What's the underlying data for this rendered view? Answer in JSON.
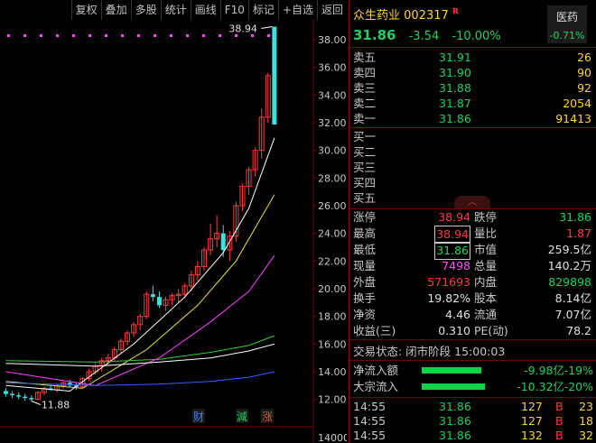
{
  "toolbar": [
    "复权",
    "叠加",
    "多股",
    "统计",
    "画线",
    "F10",
    "标记",
    "+自选",
    "返回"
  ],
  "chart_data": {
    "type": "candlestick",
    "y_ticks": [
      "38.00",
      "36.00",
      "34.00",
      "32.00",
      "30.00",
      "28.00",
      "26.00",
      "24.00",
      "22.00",
      "20.00",
      "18.00",
      "16.00",
      "14.00",
      "12.00"
    ],
    "y_range": [
      11.0,
      39.3
    ],
    "high_label": "38.94",
    "low_label": "11.88",
    "candles": [
      [
        12.6,
        12.8,
        12.2,
        12.4
      ],
      [
        12.4,
        12.6,
        12.1,
        12.3
      ],
      [
        12.3,
        12.5,
        12.0,
        12.2
      ],
      [
        12.2,
        12.4,
        11.9,
        12.1
      ],
      [
        12.1,
        12.3,
        11.88,
        12.0
      ],
      [
        12.0,
        12.6,
        11.95,
        12.5
      ],
      [
        12.5,
        12.9,
        12.3,
        12.8
      ],
      [
        12.8,
        13.0,
        12.6,
        12.7
      ],
      [
        12.7,
        13.1,
        12.5,
        13.0
      ],
      [
        13.0,
        13.3,
        12.8,
        13.2
      ],
      [
        13.2,
        13.4,
        12.9,
        13.0
      ],
      [
        13.0,
        13.2,
        12.7,
        12.9
      ],
      [
        12.9,
        13.6,
        12.8,
        13.5
      ],
      [
        13.5,
        14.2,
        13.3,
        14.0
      ],
      [
        14.0,
        14.6,
        13.8,
        14.4
      ],
      [
        14.4,
        15.0,
        14.0,
        14.8
      ],
      [
        14.8,
        15.3,
        14.5,
        15.0
      ],
      [
        15.0,
        15.8,
        14.8,
        15.6
      ],
      [
        15.6,
        16.4,
        15.3,
        16.2
      ],
      [
        16.2,
        17.0,
        15.9,
        16.8
      ],
      [
        16.8,
        17.6,
        16.5,
        17.4
      ],
      [
        17.4,
        18.2,
        17.0,
        18.0
      ],
      [
        18.0,
        19.8,
        17.8,
        19.6
      ],
      [
        19.6,
        20.2,
        19.1,
        19.4
      ],
      [
        19.4,
        19.8,
        18.6,
        18.8
      ],
      [
        18.8,
        19.4,
        18.4,
        19.2
      ],
      [
        19.2,
        19.7,
        18.8,
        19.5
      ],
      [
        19.5,
        20.0,
        19.0,
        19.6
      ],
      [
        19.6,
        20.4,
        19.3,
        20.2
      ],
      [
        20.2,
        21.3,
        19.8,
        21.0
      ],
      [
        21.0,
        22.0,
        20.6,
        21.6
      ],
      [
        21.6,
        23.0,
        21.3,
        22.8
      ],
      [
        22.8,
        24.7,
        22.4,
        23.6
      ],
      [
        23.6,
        25.3,
        23.0,
        24.0
      ],
      [
        24.0,
        24.6,
        22.3,
        22.8
      ],
      [
        22.8,
        24.2,
        22.0,
        23.8
      ],
      [
        23.8,
        26.3,
        23.4,
        26.0
      ],
      [
        26.0,
        27.6,
        25.6,
        27.4
      ],
      [
        27.4,
        28.8,
        26.8,
        28.6
      ],
      [
        28.6,
        30.2,
        28.1,
        30.0
      ],
      [
        30.0,
        33.0,
        29.4,
        32.4
      ],
      [
        32.4,
        35.6,
        32.0,
        35.4
      ],
      [
        38.94,
        38.94,
        31.86,
        31.86
      ]
    ],
    "ma_series": [
      {
        "color": "#ffffff",
        "points": [
          [
            0,
            13.0
          ],
          [
            10,
            12.6
          ],
          [
            20,
            16.0
          ],
          [
            28,
            19.4
          ],
          [
            34,
            22.6
          ],
          [
            38,
            25.8
          ],
          [
            42,
            30.9
          ]
        ]
      },
      {
        "color": "#e8e040",
        "points": [
          [
            0,
            13.3
          ],
          [
            12,
            12.8
          ],
          [
            22,
            15.6
          ],
          [
            30,
            18.8
          ],
          [
            36,
            22.0
          ],
          [
            42,
            26.8
          ]
        ]
      },
      {
        "color": "#ff40ff",
        "points": [
          [
            0,
            14.0
          ],
          [
            14,
            13.0
          ],
          [
            24,
            15.0
          ],
          [
            32,
            17.6
          ],
          [
            38,
            19.8
          ],
          [
            42,
            22.4
          ]
        ]
      },
      {
        "color": "#30d030",
        "points": [
          [
            0,
            14.8
          ],
          [
            14,
            14.7
          ],
          [
            24,
            14.9
          ],
          [
            32,
            15.4
          ],
          [
            38,
            15.9
          ],
          [
            42,
            16.6
          ]
        ]
      },
      {
        "color": "#ffffff",
        "points": [
          [
            0,
            14.6
          ],
          [
            14,
            14.4
          ],
          [
            24,
            14.7
          ],
          [
            32,
            15.0
          ],
          [
            38,
            15.5
          ],
          [
            42,
            16.0
          ]
        ]
      },
      {
        "color": "#3060ff",
        "points": [
          [
            0,
            13.2
          ],
          [
            14,
            13.0
          ],
          [
            24,
            13.1
          ],
          [
            32,
            13.3
          ],
          [
            38,
            13.6
          ],
          [
            42,
            14.0
          ]
        ]
      }
    ],
    "markers": [
      {
        "label": "财",
        "color": "#3c7cff"
      },
      {
        "label": "減",
        "color": "#20d060"
      },
      {
        "label": "涨",
        "color": "#ff3c3c"
      }
    ],
    "bottom_tick": "14000"
  },
  "stock": {
    "name": "众生药业",
    "code": "002317",
    "mark": "R",
    "price": "31.86",
    "change": "-3.54",
    "change_pct": "-10.00%",
    "sector_name": "医药",
    "sector_pct": "-0.71%"
  },
  "sell_orders": [
    {
      "label": "卖五",
      "price": "31.91",
      "vol": "26"
    },
    {
      "label": "卖四",
      "price": "31.90",
      "vol": "90"
    },
    {
      "label": "卖三",
      "price": "31.88",
      "vol": "92"
    },
    {
      "label": "卖二",
      "price": "31.87",
      "vol": "2054"
    },
    {
      "label": "卖一",
      "price": "31.86",
      "vol": "91413"
    }
  ],
  "buy_orders": [
    {
      "label": "买一",
      "price": "",
      "vol": ""
    },
    {
      "label": "买二",
      "price": "",
      "vol": ""
    },
    {
      "label": "买三",
      "price": "",
      "vol": ""
    },
    {
      "label": "买四",
      "price": "",
      "vol": ""
    },
    {
      "label": "买五",
      "price": "",
      "vol": ""
    }
  ],
  "stats": [
    {
      "l1": "涨停",
      "v1": "38.94",
      "c1": "red",
      "l2": "跌停",
      "v2": "31.86",
      "c2": "green"
    },
    {
      "l1": "最高",
      "v1": "38.94",
      "c1": "red-boxed",
      "l2": "量比",
      "v2": "1.87",
      "c2": "red"
    },
    {
      "l1": "最低",
      "v1": "31.86",
      "c1": "green-boxed",
      "l2": "市值",
      "v2": "259.5亿",
      "c2": "white"
    },
    {
      "l1": "现量",
      "v1": "7498",
      "c1": "magenta",
      "l2": "总量",
      "v2": "140.2万",
      "c2": "white"
    },
    {
      "l1": "外盘",
      "v1": "571693",
      "c1": "red",
      "l2": "内盘",
      "v2": "829898",
      "c2": "green"
    },
    {
      "l1": "换手",
      "v1": "19.82%",
      "c1": "white",
      "l2": "股本",
      "v2": "8.14亿",
      "c2": "white"
    },
    {
      "l1": "净资",
      "v1": "4.46",
      "c1": "white",
      "l2": "流通",
      "v2": "7.07亿",
      "c2": "white"
    },
    {
      "l1": "收益(三)",
      "v1": "0.310",
      "c1": "white",
      "l2": "PE(动)",
      "v2": "78.2",
      "c2": "white"
    }
  ],
  "trade_status": "交易状态: 闭市阶段 15:00:03",
  "flows": [
    {
      "label": "净流入额",
      "value": "-9.98亿",
      "pct": "-19%",
      "bar_fraction": 0.47
    },
    {
      "label": "大宗流入",
      "value": "-10.32亿",
      "pct": "-20%",
      "bar_fraction": 0.5
    }
  ],
  "ticks": [
    {
      "time": "14:55",
      "price": "31.86",
      "vol": "127",
      "bs": "B",
      "n": "23"
    },
    {
      "time": "14:55",
      "price": "31.86",
      "vol": "127",
      "bs": "B",
      "n": "18"
    },
    {
      "time": "14:55",
      "price": "31.86",
      "vol": "132",
      "bs": "B",
      "n": "32"
    }
  ],
  "colors": {
    "up": "#ff3c3c",
    "down": "#40e0e0",
    "grid": "#7a0000",
    "dots": "#ff40ff"
  }
}
